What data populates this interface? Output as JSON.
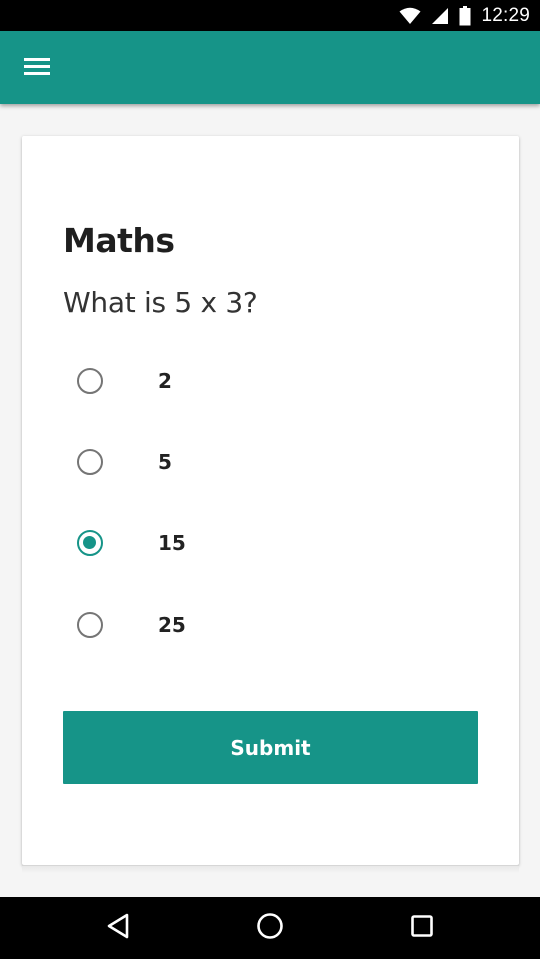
{
  "status_bar": {
    "time": "12:29",
    "icons": [
      "wifi-icon",
      "cellular-signal-icon",
      "battery-icon"
    ]
  },
  "app_bar": {
    "menu_icon": "hamburger-menu-icon",
    "color": "#169488"
  },
  "quiz": {
    "title": "Maths",
    "question": "What is 5 x 3?",
    "options": [
      {
        "label": "2",
        "selected": false
      },
      {
        "label": "5",
        "selected": false
      },
      {
        "label": "15",
        "selected": true
      },
      {
        "label": "25",
        "selected": false
      }
    ],
    "submit_label": "Submit"
  },
  "nav_bar": {
    "icons": [
      "back-icon",
      "home-icon",
      "recents-icon"
    ]
  },
  "colors": {
    "accent": "#169488",
    "radio_unselected": "#757575",
    "text": "#1f1f1f"
  }
}
